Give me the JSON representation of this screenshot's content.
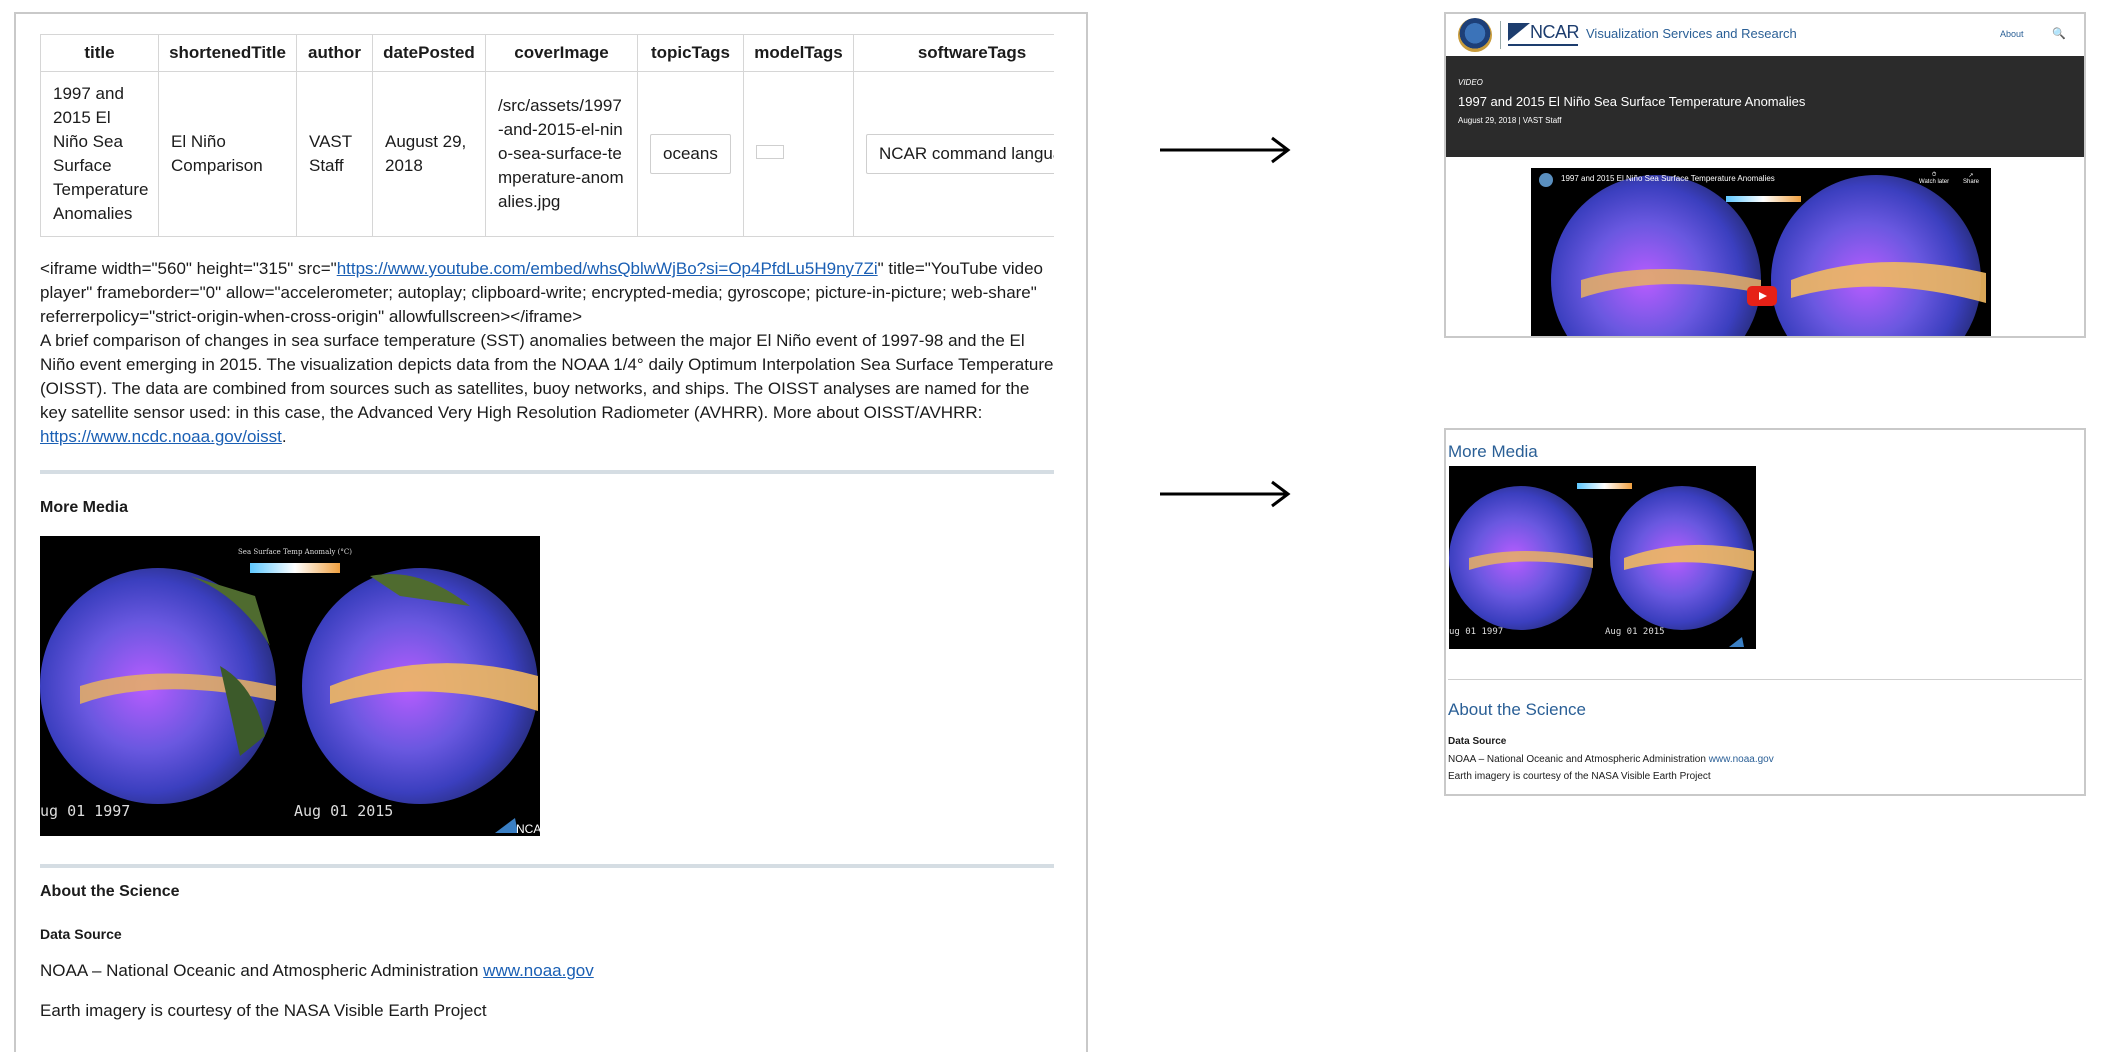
{
  "table": {
    "headers": [
      "title",
      "shortenedTitle",
      "author",
      "datePosted",
      "coverImage",
      "topicTags",
      "modelTags",
      "softwareTags"
    ],
    "row": {
      "title": "1997 and 2015 El Niño Sea Surface Temperature Anomalies",
      "shortenedTitle": "El Niño Comparison",
      "author": "VAST Staff",
      "datePosted": "August 29, 2018",
      "coverImage": "/src/assets/1997-and-2015-el-nino-sea-surface-temperature-anomalies.jpg",
      "topicTag": "oceans",
      "softwareTag": "NCAR command langua"
    }
  },
  "body": {
    "iframe_prefix": "<iframe width=\"560\" height=\"315\" src=\"",
    "iframe_url": "https://www.youtube.com/embed/whsQblwWjBo?si=Op4PfdLu5H9ny7Zi",
    "iframe_suffix": "\" title=\"YouTube video player\" frameborder=\"0\" allow=\"accelerometer; autoplay; clipboard-write; encrypted-media; gyroscope; picture-in-picture; web-share\" referrerpolicy=\"strict-origin-when-cross-origin\" allowfullscreen></iframe>",
    "description": "A brief comparison of changes in sea surface temperature (SST) anomalies between the major El Niño event of 1997-98 and the El Niño event emerging in 2015. The visualization depicts data from the NOAA 1/4° daily Optimum Interpolation Sea Surface Temperature (OISST). The data are combined from sources such as satellites, buoy networks, and ships. The OISST analyses are named for the key satellite sensor used: in this case, the Advanced Very High Resolution Radiometer (AVHRR). More about OISST/AVHRR: ",
    "oisst_link": "https://www.ncdc.noaa.gov/oisst",
    "period": "."
  },
  "more_media": {
    "heading": "More Media",
    "image_label_left": "ug 01 1997",
    "image_label_right": "Aug 01 2015",
    "image_legend": "Sea Surface Temp Anomaly (°C)",
    "image_logo_text": "NCA"
  },
  "about": {
    "heading": "About the Science",
    "data_source_heading": "Data Source",
    "noaa_text": "NOAA – National Oceanic and Atmospheric Administration ",
    "noaa_link": "www.noaa.gov",
    "earth_text": "Earth imagery is courtesy of the NASA Visible Earth Project"
  },
  "site": {
    "logo_text": "NCAR",
    "title": "Visualization Services and Research",
    "nav_about": "About",
    "search_glyph": "🔍",
    "kicker": "VIDEO",
    "hero_title": "1997 and 2015 El Niño Sea Surface Temperature Anomalies",
    "hero_meta": "August 29, 2018 | VAST Staff",
    "video_title": "1997 and 2015 El Niño Sea Surface Temperature Anomalies",
    "watch_later": "Watch later",
    "share": "Share",
    "bottom_more": "More Media",
    "bottom_label_left": "ug 01 1997",
    "bottom_label_right": "Aug 01 2015",
    "bottom_about": "About the Science",
    "bottom_data": "Data Source",
    "bottom_noaa_text": "NOAA – National Oceanic and Atmospheric Administration ",
    "bottom_noaa_link": "www.noaa.gov",
    "bottom_earth": "Earth imagery is courtesy of the NASA Visible Earth Project"
  },
  "colors": {
    "link": "#1a5fb4",
    "site_accent": "#2a5f96",
    "hero_bg": "#2b2b2b",
    "rule": "#d5dde3"
  },
  "icons": [
    "right-arrow-icon",
    "search-icon",
    "nsf-logo-icon",
    "youtube-play-icon",
    "watch-later-icon",
    "share-icon"
  ]
}
